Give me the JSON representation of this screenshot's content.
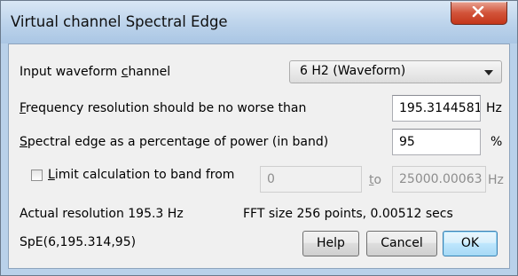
{
  "window": {
    "title": "Virtual channel Spectral Edge"
  },
  "input_channel": {
    "label_pre": "Input waveform ",
    "label_accel": "c",
    "label_post": "hannel",
    "selected": "6 H2 (Waveform)"
  },
  "frequency_resolution": {
    "label_accel": "F",
    "label_post": "requency resolution should be no worse than",
    "value": "195.3144581",
    "unit": "Hz"
  },
  "spectral_edge": {
    "label_accel": "S",
    "label_post": "pectral edge as a percentage of power (in band)",
    "value": "95",
    "unit": "%"
  },
  "limit_band": {
    "checked": false,
    "label_accel": "L",
    "label_post": "imit calculation to band from",
    "from_value": "0",
    "to_label_accel": "t",
    "to_label_post": "o",
    "to_value": "25000.00063",
    "unit": "Hz"
  },
  "info": {
    "actual_resolution": "Actual resolution  195.3 Hz",
    "fft_size": "FFT size  256 points, 0.00512 secs",
    "expression": "SpE(6,195.314,95)"
  },
  "buttons": {
    "help": "Help",
    "cancel": "Cancel",
    "ok": "OK"
  }
}
